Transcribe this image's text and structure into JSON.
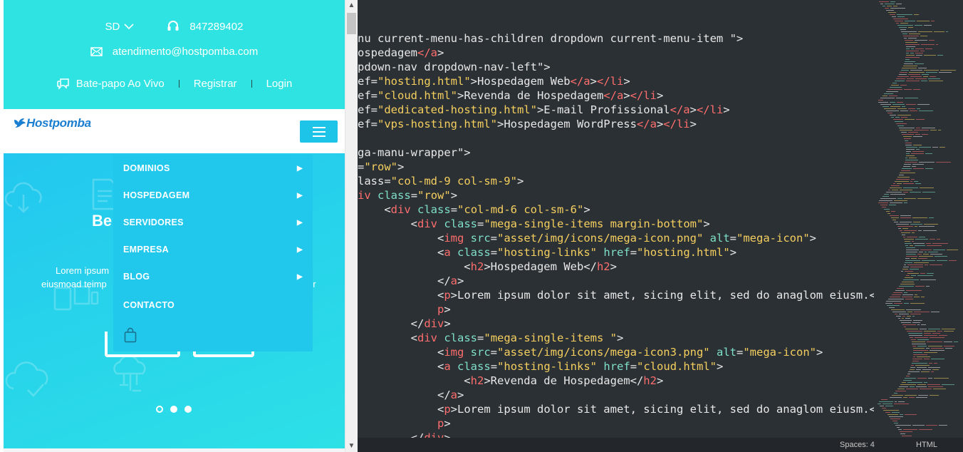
{
  "site": {
    "topbar": {
      "language": "SD",
      "phone": "847289402",
      "email": "atendimento@hostpomba.com",
      "live_chat": "Bate-papo Ao Vivo",
      "register": "Registrar",
      "login": "Login"
    },
    "logo_text": "Hostpomba",
    "menu": [
      {
        "label": "DOMINIOS",
        "has_submenu": true
      },
      {
        "label": "HOSPEDAGEM",
        "has_submenu": true
      },
      {
        "label": "SERVIDORES",
        "has_submenu": true
      },
      {
        "label": "EMPRESA",
        "has_submenu": true
      },
      {
        "label": "BLOG",
        "has_submenu": true
      },
      {
        "label": "CONTACTO",
        "has_submenu": false
      }
    ],
    "menu_arrow": "▶",
    "hero": {
      "title_partial": "Be",
      "text_line1_partial": "Lorem ipsum",
      "text_line2_partial": "eiusmoad teimp",
      "text_line2_tail": "or"
    },
    "slider_dots": 3
  },
  "editor": {
    "lines": [
      [
        [
          "p",
          "nu current-menu-has-children dropdown current-menu-item \">"
        ]
      ],
      [
        [
          "p",
          "ospedagem"
        ],
        [
          "t",
          "</a"
        ],
        [
          "p",
          ">"
        ]
      ],
      [
        [
          "p",
          "pdown-nav dropdown-nav-left\">"
        ]
      ],
      [
        [
          "p",
          "ef="
        ],
        [
          "s",
          "\"hosting.html\""
        ],
        [
          "p",
          ">Hospedagem Web"
        ],
        [
          "t",
          "</a"
        ],
        [
          "p",
          ">"
        ],
        [
          "t",
          "</li"
        ],
        [
          "p",
          ">"
        ]
      ],
      [
        [
          "p",
          "ef="
        ],
        [
          "s",
          "\"cloud.html\""
        ],
        [
          "p",
          ">Revenda de Hospedagem"
        ],
        [
          "t",
          "</a"
        ],
        [
          "p",
          ">"
        ],
        [
          "t",
          "</li"
        ],
        [
          "p",
          ">"
        ]
      ],
      [
        [
          "p",
          "ef="
        ],
        [
          "s",
          "\"dedicated-hosting.html\""
        ],
        [
          "p",
          ">E-mail Profissional"
        ],
        [
          "t",
          "</a"
        ],
        [
          "p",
          ">"
        ],
        [
          "t",
          "</li"
        ],
        [
          "p",
          ">"
        ]
      ],
      [
        [
          "p",
          "ef="
        ],
        [
          "s",
          "\"vps-hosting.html\""
        ],
        [
          "p",
          ">Hospedagem WordPress"
        ],
        [
          "t",
          "</a"
        ],
        [
          "p",
          ">"
        ],
        [
          "t",
          "</li"
        ],
        [
          "p",
          ">"
        ]
      ],
      [],
      [
        [
          "p",
          "ga-manu-wrapper\">"
        ]
      ],
      [
        [
          "p",
          "="
        ],
        [
          "s",
          "\"row\""
        ],
        [
          "p",
          ">"
        ]
      ],
      [
        [
          "p",
          "lass="
        ],
        [
          "s",
          "\"col-md-9 col-sm-9\""
        ],
        [
          "p",
          ">"
        ]
      ],
      [
        [
          "t",
          "iv"
        ],
        [
          "p",
          " "
        ],
        [
          "a",
          "class"
        ],
        [
          "p",
          "="
        ],
        [
          "s",
          "\"row\""
        ],
        [
          "p",
          ">"
        ]
      ],
      [
        [
          "p",
          "    <"
        ],
        [
          "t",
          "div"
        ],
        [
          "p",
          " "
        ],
        [
          "a",
          "class"
        ],
        [
          "p",
          "="
        ],
        [
          "s",
          "\"col-md-6 col-sm-6\""
        ],
        [
          "p",
          ">"
        ]
      ],
      [
        [
          "p",
          "        <"
        ],
        [
          "t",
          "div"
        ],
        [
          "p",
          " "
        ],
        [
          "a",
          "class"
        ],
        [
          "p",
          "="
        ],
        [
          "s",
          "\"mega-single-items margin-bottom\""
        ],
        [
          "p",
          ">"
        ]
      ],
      [
        [
          "p",
          "            <"
        ],
        [
          "t",
          "img"
        ],
        [
          "p",
          " "
        ],
        [
          "a",
          "src"
        ],
        [
          "p",
          "="
        ],
        [
          "s",
          "\"asset/img/icons/mega-icon.png\""
        ],
        [
          "p",
          " "
        ],
        [
          "a",
          "alt"
        ],
        [
          "p",
          "="
        ],
        [
          "s",
          "\"mega-icon\""
        ],
        [
          "p",
          ">"
        ]
      ],
      [
        [
          "p",
          "            <"
        ],
        [
          "t",
          "a"
        ],
        [
          "p",
          " "
        ],
        [
          "a",
          "class"
        ],
        [
          "p",
          "="
        ],
        [
          "s",
          "\"hosting-links\""
        ],
        [
          "p",
          " "
        ],
        [
          "a",
          "href"
        ],
        [
          "p",
          "="
        ],
        [
          "s",
          "\"hosting.html\""
        ],
        [
          "p",
          ">"
        ]
      ],
      [
        [
          "p",
          "                <"
        ],
        [
          "t",
          "h2"
        ],
        [
          "p",
          ">Hospedagem Web</"
        ],
        [
          "t",
          "h2"
        ],
        [
          "p",
          ">"
        ]
      ],
      [
        [
          "p",
          "            </"
        ],
        [
          "t",
          "a"
        ],
        [
          "p",
          ">"
        ]
      ],
      [
        [
          "p",
          "            <"
        ],
        [
          "t",
          "p"
        ],
        [
          "p",
          ">Lorem ipsum dolor sit amet, sicing elit, sed do anaglom eiusm.</"
        ]
      ],
      [
        [
          "p",
          "            "
        ],
        [
          "t",
          "p"
        ],
        [
          "p",
          ">"
        ]
      ],
      [
        [
          "p",
          "        </"
        ],
        [
          "t",
          "div"
        ],
        [
          "p",
          ">"
        ]
      ],
      [
        [
          "p",
          "        <"
        ],
        [
          "t",
          "div"
        ],
        [
          "p",
          " "
        ],
        [
          "a",
          "class"
        ],
        [
          "p",
          "="
        ],
        [
          "s",
          "\"mega-single-items \""
        ],
        [
          "p",
          ">"
        ]
      ],
      [
        [
          "p",
          "            <"
        ],
        [
          "t",
          "img"
        ],
        [
          "p",
          " "
        ],
        [
          "a",
          "src"
        ],
        [
          "p",
          "="
        ],
        [
          "s",
          "\"asset/img/icons/mega-icon3.png\""
        ],
        [
          "p",
          " "
        ],
        [
          "a",
          "alt"
        ],
        [
          "p",
          "="
        ],
        [
          "s",
          "\"mega-icon\""
        ],
        [
          "p",
          ">"
        ]
      ],
      [
        [
          "p",
          "            <"
        ],
        [
          "t",
          "a"
        ],
        [
          "p",
          " "
        ],
        [
          "a",
          "class"
        ],
        [
          "p",
          "="
        ],
        [
          "s",
          "\"hosting-links\""
        ],
        [
          "p",
          " "
        ],
        [
          "a",
          "href"
        ],
        [
          "p",
          "="
        ],
        [
          "s",
          "\"cloud.html\""
        ],
        [
          "p",
          ">"
        ]
      ],
      [
        [
          "p",
          "                <"
        ],
        [
          "t",
          "h2"
        ],
        [
          "p",
          ">Revenda de Hospedagem</"
        ],
        [
          "t",
          "h2"
        ],
        [
          "p",
          ">"
        ]
      ],
      [
        [
          "p",
          "            </"
        ],
        [
          "t",
          "a"
        ],
        [
          "p",
          ">"
        ]
      ],
      [
        [
          "p",
          "            <"
        ],
        [
          "t",
          "p"
        ],
        [
          "p",
          ">Lorem ipsum dolor sit amet, sicing elit, sed do anaglom eiusm.</"
        ]
      ],
      [
        [
          "p",
          "            "
        ],
        [
          "t",
          "p"
        ],
        [
          "p",
          ">"
        ]
      ],
      [
        [
          "p",
          "        </"
        ],
        [
          "t",
          "div"
        ],
        [
          "p",
          ">"
        ]
      ]
    ],
    "status": {
      "indentation": "Spaces: 4",
      "syntax": "HTML"
    }
  },
  "colors": {
    "topbar_bg": "#2fe3e3",
    "dropdown_bg": "#22c7ec",
    "menu_button": "#1ec4e8",
    "logo": "#1b7fd1",
    "editor_bg": "#2b3035",
    "tag": "#ff6d6d",
    "attr": "#7ee0c8",
    "string": "#f5cf5e"
  }
}
